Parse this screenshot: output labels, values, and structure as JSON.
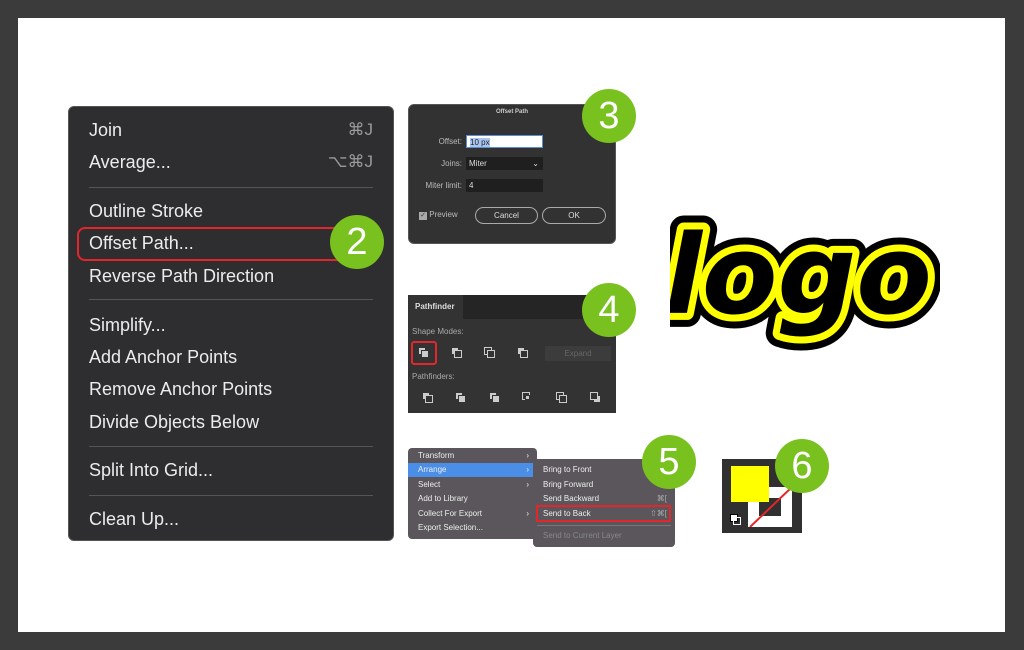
{
  "main_menu": {
    "items": [
      {
        "label": "Join",
        "shortcut": "⌘J"
      },
      {
        "label": "Average...",
        "shortcut": "⌥⌘J"
      },
      {
        "label": "Outline Stroke"
      },
      {
        "label": "Offset Path..."
      },
      {
        "label": "Reverse Path Direction"
      },
      {
        "label": "Simplify..."
      },
      {
        "label": "Add Anchor Points"
      },
      {
        "label": "Remove Anchor Points"
      },
      {
        "label": "Divide Objects Below"
      },
      {
        "label": "Split Into Grid..."
      },
      {
        "label": "Clean Up..."
      }
    ],
    "selected": "Offset Path..."
  },
  "badges": [
    "2",
    "3",
    "4",
    "5",
    "6"
  ],
  "offset_dialog": {
    "title": "Offset Path",
    "offset_label": "Offset:",
    "offset_value": "10 px",
    "joins_label": "Joins:",
    "joins_value": "Miter",
    "miter_label": "Miter limit:",
    "miter_value": "4",
    "preview_label": "Preview",
    "preview_checked": true,
    "cancel": "Cancel",
    "ok": "OK"
  },
  "pathfinder": {
    "tab": "Pathfinder",
    "shape_modes": "Shape Modes:",
    "expand": "Expand",
    "pathfinders": "Pathfinders:"
  },
  "context_menu": {
    "items": [
      {
        "label": "Transform",
        "submenu": true
      },
      {
        "label": "Arrange",
        "submenu": true,
        "highlighted": true
      },
      {
        "label": "Select",
        "submenu": true
      },
      {
        "label": "Add to Library"
      },
      {
        "label": "Collect For Export",
        "submenu": true
      },
      {
        "label": "Export Selection..."
      }
    ],
    "submenu": [
      {
        "label": "Bring to Front",
        "shortcut": ""
      },
      {
        "label": "Bring Forward",
        "shortcut": ""
      },
      {
        "label": "Send Backward",
        "shortcut": "⌘["
      },
      {
        "label": "Send to Back",
        "shortcut": "⇧⌘["
      },
      {
        "label": "Send to Current Layer",
        "disabled": true
      }
    ]
  },
  "logo": {
    "text": "logo",
    "fill": "#000000",
    "stroke": "#ffff00"
  },
  "colors": {
    "accent_green": "#79c11f",
    "highlight_red": "#e3262b",
    "fill_yellow": "#ffff00",
    "menu_blue": "#4a8ee8"
  }
}
